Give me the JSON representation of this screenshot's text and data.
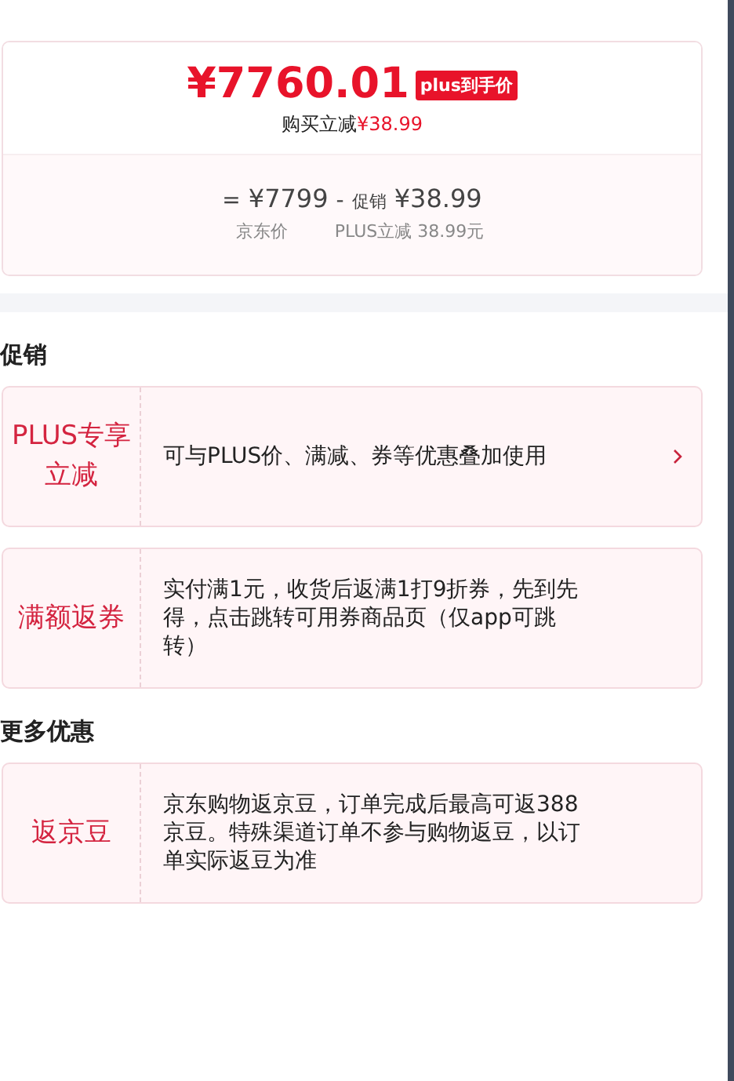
{
  "price_card": {
    "final_price": "¥7760.01",
    "badge": "plus到手价",
    "saving_label": "购买立减",
    "saving_amount": "¥38.99",
    "breakdown": {
      "equals": "=",
      "base_price": "¥7799",
      "minus": "-",
      "promo_label": "促销",
      "promo_amount": "¥38.99",
      "base_caption": "京东价",
      "promo_caption": "PLUS立减 38.99元"
    }
  },
  "sections": [
    {
      "title": "促销",
      "items": [
        {
          "tag": "PLUS专享立减",
          "text": "可与PLUS价、满减、券等优惠叠加使用",
          "has_arrow": true
        },
        {
          "tag": "满额返券",
          "text": "实付满1元，收货后返满1打9折券，先到先得，点击跳转可用券商品页（仅app可跳转）",
          "has_arrow": false
        }
      ]
    },
    {
      "title": "更多优惠",
      "items": [
        {
          "tag": "返京豆",
          "text": "京东购物返京豆，订单完成后最高可返388京豆。特殊渠道订单不参与购物返豆，以订单实际返豆为准",
          "has_arrow": false
        }
      ]
    }
  ]
}
